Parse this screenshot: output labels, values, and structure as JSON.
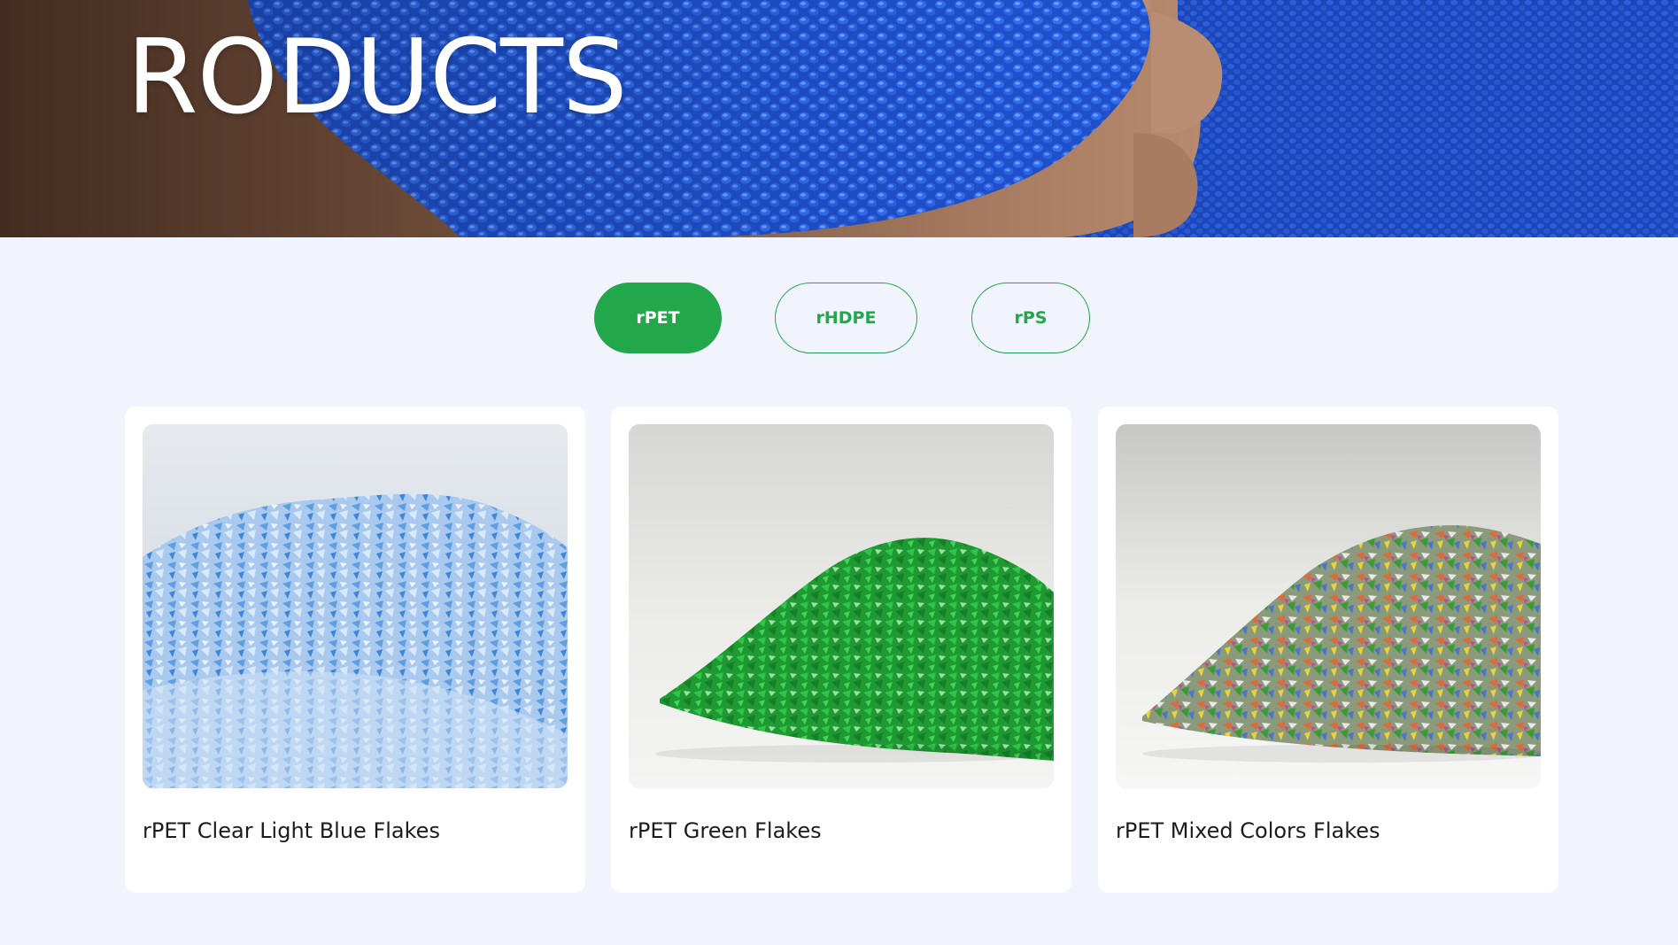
{
  "hero": {
    "title": "RODUCTS"
  },
  "tabs": [
    {
      "label": "rPET",
      "active": true
    },
    {
      "label": "rHDPE",
      "active": false
    },
    {
      "label": "rPS",
      "active": false
    }
  ],
  "products": [
    {
      "title": "rPET Clear Light Blue Flakes",
      "image": "light-blue-pet-flakes"
    },
    {
      "title": "rPET Green Flakes",
      "image": "green-pet-flakes"
    },
    {
      "title": "rPET Mixed Colors Flakes",
      "image": "mixed-color-pet-flakes"
    }
  ],
  "colors": {
    "accent": "#22a74a",
    "page_bg": "#f1f3fd",
    "card_bg": "#ffffff",
    "title_text": "#1c1c1c"
  }
}
